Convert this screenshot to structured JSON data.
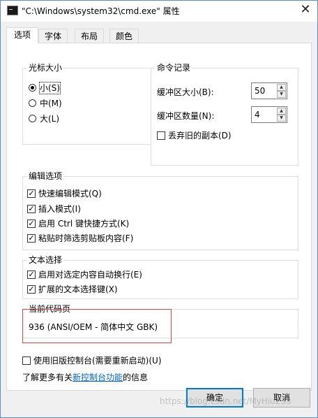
{
  "window": {
    "title": "\"C:\\Windows\\system32\\cmd.exe\" 属性",
    "close_glyph": "✕"
  },
  "tabs": [
    {
      "label": "选项",
      "active": true
    },
    {
      "label": "字体",
      "active": false
    },
    {
      "label": "布局",
      "active": false
    },
    {
      "label": "颜色",
      "active": false
    }
  ],
  "cursor_size": {
    "label": "光标大小",
    "options": [
      {
        "label": "小(S)",
        "checked": true
      },
      {
        "label": "中(M)",
        "checked": false
      },
      {
        "label": "大(L)",
        "checked": false
      }
    ]
  },
  "command_history": {
    "label": "命令记录",
    "buffer_size_label": "缓冲区大小(B):",
    "buffer_size_value": "50",
    "buffer_count_label": "缓冲区数量(N):",
    "buffer_count_value": "4",
    "discard_old_label": "丢弃旧的副本(D)",
    "discard_old_checked": false
  },
  "edit_options": {
    "label": "编辑选项",
    "items": [
      {
        "label": "快速编辑模式(Q)",
        "checked": true
      },
      {
        "label": "插入模式(I)",
        "checked": true
      },
      {
        "label": "启用 Ctrl 键快捷方式(K)",
        "checked": true
      },
      {
        "label": "粘贴时筛选剪贴板内容(F)",
        "checked": true
      }
    ]
  },
  "text_selection": {
    "label": "文本选择",
    "items": [
      {
        "label": "启用对选定内容自动换行(E)",
        "checked": true
      },
      {
        "label": "扩展的文本选择键(X)",
        "checked": true
      }
    ]
  },
  "code_page": {
    "label": "当前代码页",
    "value": "936   (ANSI/OEM - 简体中文 GBK)"
  },
  "legacy_console": {
    "label": "使用旧版控制台(需要重新启动)(U)",
    "checked": false
  },
  "learn_more": {
    "prefix": "了解更多有关",
    "link": "新控制台功能",
    "suffix": "的信息"
  },
  "buttons": {
    "ok": "确定",
    "cancel": "取消"
  },
  "watermark": "https://blog.csdn.net/MyHiu233"
}
